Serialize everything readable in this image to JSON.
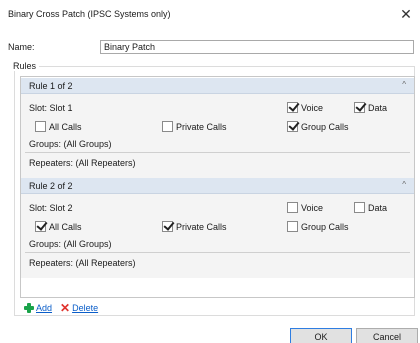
{
  "window": {
    "title": "Binary Cross Patch (IPSC Systems only)",
    "close": "✕"
  },
  "name_field": {
    "label": "Name:",
    "value": "Binary Patch"
  },
  "rules_group_label": "Rules",
  "rules": [
    {
      "header": "Rule 1 of 2",
      "collapse": "^",
      "slot": "Slot:  Slot 1",
      "voice": {
        "label": "Voice",
        "checked": true
      },
      "data": {
        "label": "Data",
        "checked": true
      },
      "all_calls": {
        "label": "All Calls",
        "checked": false
      },
      "private_calls": {
        "label": "Private Calls",
        "checked": false
      },
      "group_calls": {
        "label": "Group Calls",
        "checked": true
      },
      "groups": "Groups:  (All Groups)",
      "repeaters": "Repeaters:  (All Repeaters)"
    },
    {
      "header": "Rule 2 of 2",
      "collapse": "^",
      "slot": "Slot:  Slot 2",
      "voice": {
        "label": "Voice",
        "checked": false
      },
      "data": {
        "label": "Data",
        "checked": false
      },
      "all_calls": {
        "label": "All Calls",
        "checked": true
      },
      "private_calls": {
        "label": "Private Calls",
        "checked": true
      },
      "group_calls": {
        "label": "Group Calls",
        "checked": false
      },
      "groups": "Groups:  (All Groups)",
      "repeaters": "Repeaters:  (All Repeaters)"
    }
  ],
  "actions": {
    "add": "Add",
    "delete": "Delete"
  },
  "buttons": {
    "ok": "OK",
    "cancel": "Cancel"
  },
  "colors": {
    "header_bg": "#dde6f1",
    "link": "#0b5ec9",
    "add_green": "#1aa34a",
    "delete_red": "#e0322c"
  }
}
